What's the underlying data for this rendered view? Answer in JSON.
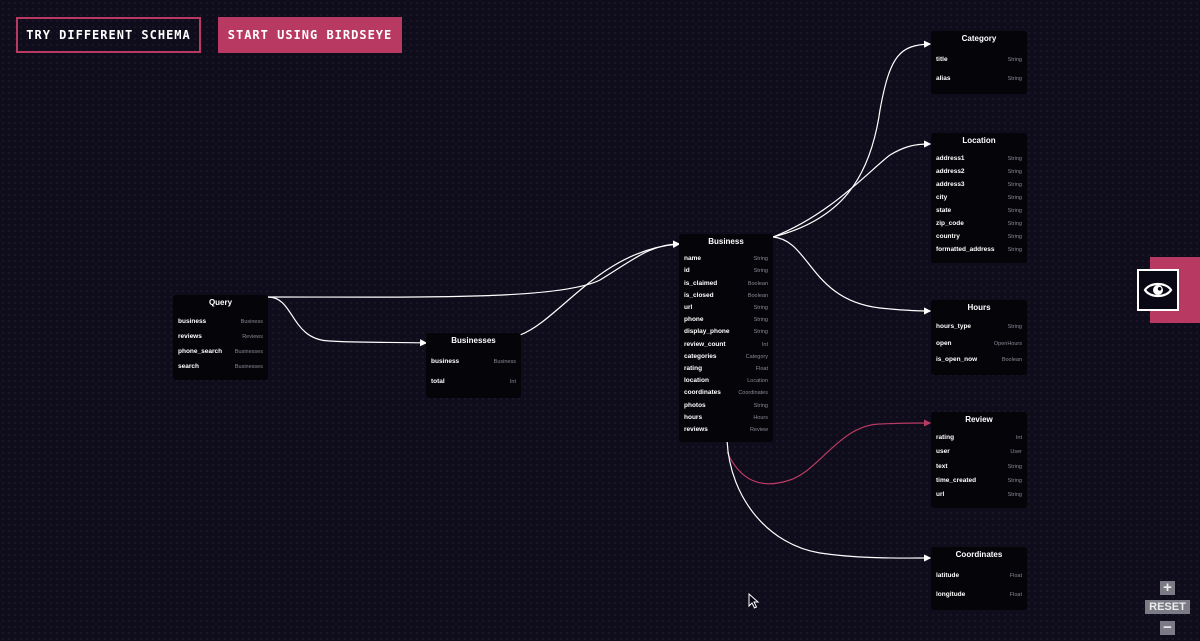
{
  "toolbar": {
    "try_label": "TRY DIFFERENT SCHEMA",
    "start_label": "START USING BIRDSEYE"
  },
  "colors": {
    "accent": "#b83a62",
    "background": "#0f0c1c",
    "node_bg": "#050409",
    "edge": "#ffffff",
    "highlight_edge": "#b83a62"
  },
  "nodes": [
    {
      "id": "query",
      "title": "Query",
      "fields": [
        {
          "name": "business",
          "type": "Business"
        },
        {
          "name": "reviews",
          "type": "Reviews"
        },
        {
          "name": "phone_search",
          "type": "Businesses"
        },
        {
          "name": "search",
          "type": "Businesses"
        }
      ]
    },
    {
      "id": "businesses",
      "title": "Businesses",
      "fields": [
        {
          "name": "business",
          "type": "Business"
        },
        {
          "name": "total",
          "type": "Int"
        }
      ]
    },
    {
      "id": "business",
      "title": "Business",
      "fields": [
        {
          "name": "name",
          "type": "String"
        },
        {
          "name": "id",
          "type": "String"
        },
        {
          "name": "is_claimed",
          "type": "Boolean"
        },
        {
          "name": "is_closed",
          "type": "Boolean"
        },
        {
          "name": "url",
          "type": "String"
        },
        {
          "name": "phone",
          "type": "String"
        },
        {
          "name": "display_phone",
          "type": "String"
        },
        {
          "name": "review_count",
          "type": "Int"
        },
        {
          "name": "categories",
          "type": "Category"
        },
        {
          "name": "rating",
          "type": "Float"
        },
        {
          "name": "location",
          "type": "Location"
        },
        {
          "name": "coordinates",
          "type": "Coordinates"
        },
        {
          "name": "photos",
          "type": "String"
        },
        {
          "name": "hours",
          "type": "Hours"
        },
        {
          "name": "reviews",
          "type": "Review"
        }
      ]
    },
    {
      "id": "category",
      "title": "Category",
      "fields": [
        {
          "name": "title",
          "type": "String"
        },
        {
          "name": "alias",
          "type": "String"
        }
      ]
    },
    {
      "id": "location",
      "title": "Location",
      "fields": [
        {
          "name": "address1",
          "type": "String"
        },
        {
          "name": "address2",
          "type": "String"
        },
        {
          "name": "address3",
          "type": "String"
        },
        {
          "name": "city",
          "type": "String"
        },
        {
          "name": "state",
          "type": "String"
        },
        {
          "name": "zip_code",
          "type": "String"
        },
        {
          "name": "country",
          "type": "String"
        },
        {
          "name": "formatted_address",
          "type": "String"
        }
      ]
    },
    {
      "id": "hours",
      "title": "Hours",
      "fields": [
        {
          "name": "hours_type",
          "type": "String"
        },
        {
          "name": "open",
          "type": "OpenHours"
        },
        {
          "name": "is_open_now",
          "type": "Boolean"
        }
      ]
    },
    {
      "id": "review",
      "title": "Review",
      "fields": [
        {
          "name": "rating",
          "type": "Int"
        },
        {
          "name": "user",
          "type": "User"
        },
        {
          "name": "text",
          "type": "String"
        },
        {
          "name": "time_created",
          "type": "String"
        },
        {
          "name": "url",
          "type": "String"
        }
      ]
    },
    {
      "id": "coordinates",
      "title": "Coordinates",
      "fields": [
        {
          "name": "latitude",
          "type": "Float"
        },
        {
          "name": "longitude",
          "type": "Float"
        }
      ]
    }
  ],
  "edges": [
    {
      "from": "query",
      "to": "business"
    },
    {
      "from": "query",
      "to": "businesses"
    },
    {
      "from": "businesses",
      "to": "business"
    },
    {
      "from": "business",
      "to": "category"
    },
    {
      "from": "business",
      "to": "location"
    },
    {
      "from": "business",
      "to": "hours"
    },
    {
      "from": "business",
      "to": "review",
      "highlight": true
    },
    {
      "from": "business",
      "to": "coordinates"
    }
  ],
  "eye_button": {
    "icon": "eye-icon"
  },
  "zoom": {
    "in_label": "+",
    "reset_label": "RESET",
    "out_label": "−"
  }
}
